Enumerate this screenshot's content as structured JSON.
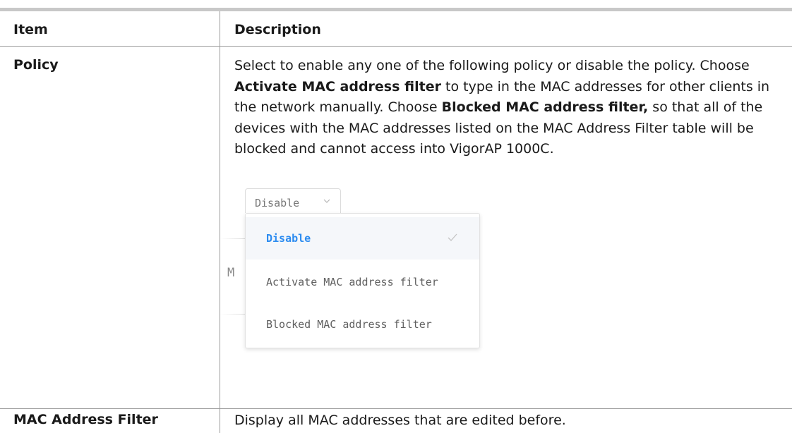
{
  "table": {
    "headers": {
      "item": "Item",
      "description": "Description"
    },
    "rows": [
      {
        "item": "Policy",
        "desc_parts": [
          "Select to enable any one of the following policy or disable the policy. Choose ",
          "Activate MAC address filter",
          " to type in the MAC addresses for other clients in the network manually. Choose ",
          "Blocked MAC address filter,",
          " so that all of the devices with the MAC addresses listed on the MAC Address Filter table will be blocked and cannot access into VigorAP 1000C."
        ]
      },
      {
        "item": "MAC Address Filter",
        "description": "Display all MAC addresses that are edited before."
      }
    ]
  },
  "dropdown": {
    "selected_value": "Disable",
    "background_label_fragment": "M",
    "options": [
      "Disable",
      "Activate MAC address filter",
      "Blocked MAC address filter"
    ],
    "selected_index": 0,
    "accent_color": "#2d8cf0"
  }
}
